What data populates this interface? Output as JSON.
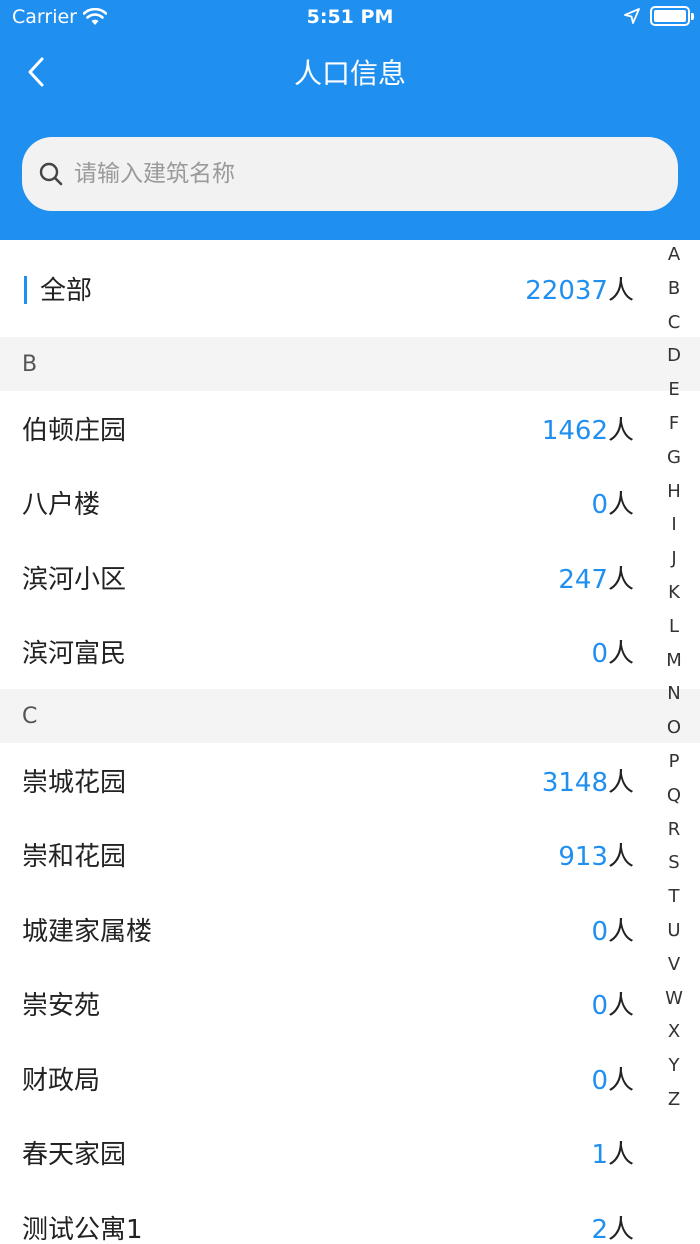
{
  "status_bar": {
    "carrier": "Carrier",
    "time": "5:51 PM"
  },
  "nav": {
    "title": "人口信息"
  },
  "search": {
    "placeholder": "请输入建筑名称"
  },
  "summary": {
    "label": "全部",
    "count": "22037",
    "unit": "人"
  },
  "sections": [
    {
      "letter": "B",
      "items": [
        {
          "name": "伯顿庄园",
          "count": "1462",
          "unit": "人"
        },
        {
          "name": "八户楼",
          "count": "0",
          "unit": "人"
        },
        {
          "name": "滨河小区",
          "count": "247",
          "unit": "人"
        },
        {
          "name": "滨河富民",
          "count": "0",
          "unit": "人"
        }
      ]
    },
    {
      "letter": "C",
      "items": [
        {
          "name": "崇城花园",
          "count": "3148",
          "unit": "人"
        },
        {
          "name": "崇和花园",
          "count": "913",
          "unit": "人"
        },
        {
          "name": "城建家属楼",
          "count": "0",
          "unit": "人"
        },
        {
          "name": "崇安苑",
          "count": "0",
          "unit": "人"
        },
        {
          "name": "财政局",
          "count": "0",
          "unit": "人"
        },
        {
          "name": "春天家园",
          "count": "1",
          "unit": "人"
        },
        {
          "name": "测试公寓1",
          "count": "2",
          "unit": "人"
        }
      ]
    }
  ],
  "index_letters": [
    "A",
    "B",
    "C",
    "D",
    "E",
    "F",
    "G",
    "H",
    "I",
    "J",
    "K",
    "L",
    "M",
    "N",
    "O",
    "P",
    "Q",
    "R",
    "S",
    "T",
    "U",
    "V",
    "W",
    "X",
    "Y",
    "Z"
  ],
  "colors": {
    "primary": "#2090f0",
    "section_bg": "#f4f4f4",
    "search_bg": "#f2f2f2"
  }
}
